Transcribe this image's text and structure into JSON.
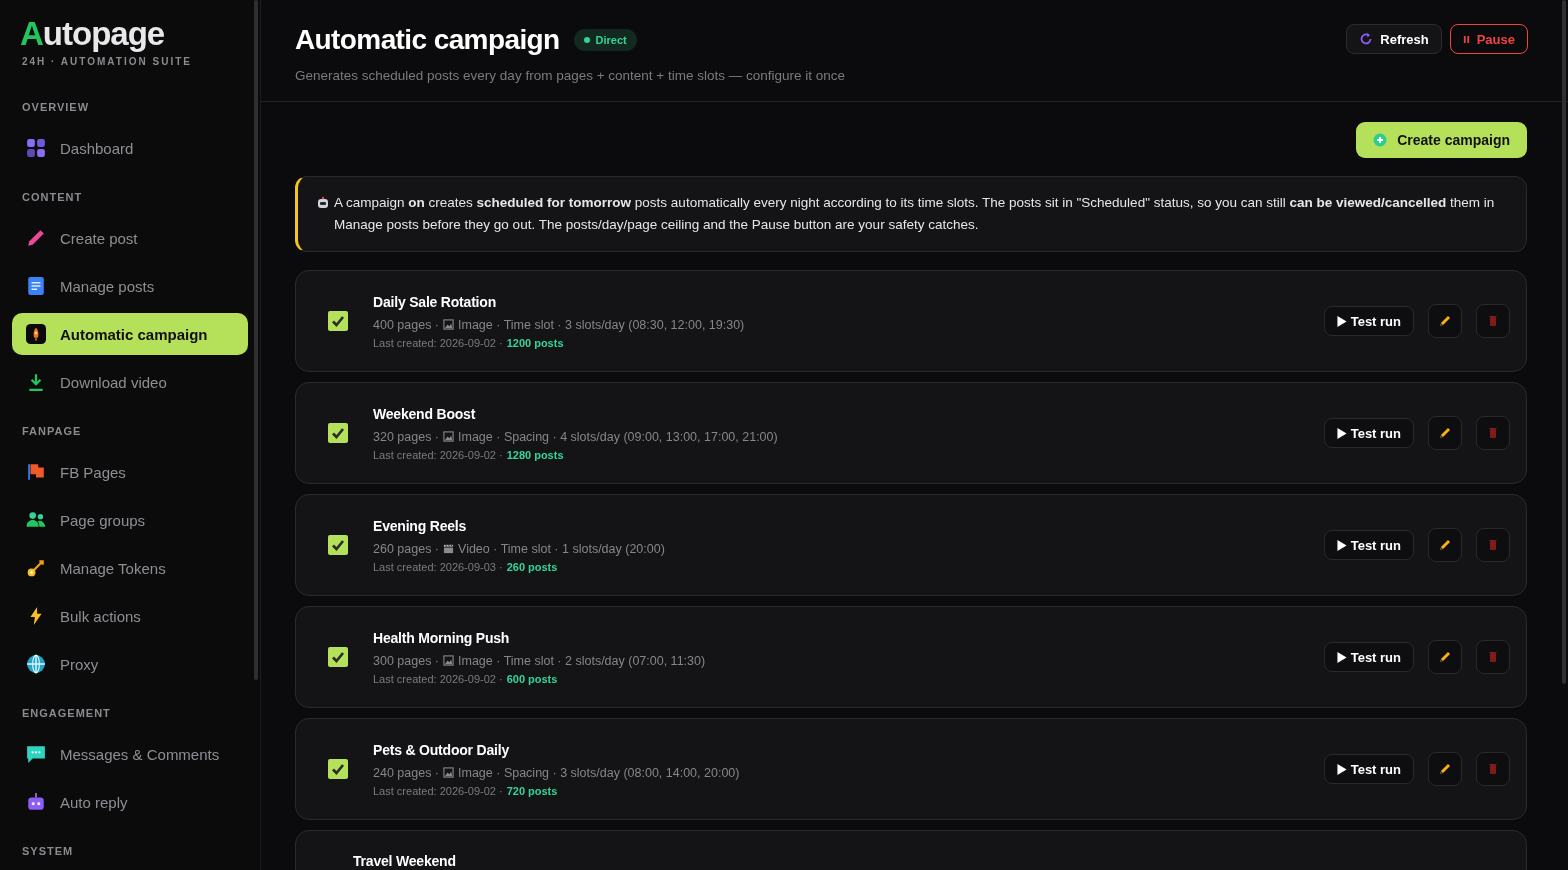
{
  "brand": {
    "logo_first": "A",
    "logo_rest": "utopage",
    "tagline": "24H · AUTOMATION SUITE"
  },
  "sidebar": {
    "sections": [
      {
        "heading": "OVERVIEW",
        "items": [
          {
            "label": "Dashboard",
            "kind": "dashboard",
            "selected": false
          }
        ]
      },
      {
        "heading": "CONTENT",
        "items": [
          {
            "label": "Create post",
            "kind": "pencil",
            "selected": false
          },
          {
            "label": "Manage posts",
            "kind": "document",
            "selected": false
          },
          {
            "label": "Automatic campaign",
            "kind": "rocket",
            "selected": true
          },
          {
            "label": "Download video",
            "kind": "download",
            "selected": false
          }
        ]
      },
      {
        "heading": "FANPAGE",
        "items": [
          {
            "label": "FB Pages",
            "kind": "flag",
            "selected": false
          },
          {
            "label": "Page groups",
            "kind": "people",
            "selected": false
          },
          {
            "label": "Manage Tokens",
            "kind": "key",
            "selected": false
          },
          {
            "label": "Bulk actions",
            "kind": "bolt",
            "selected": false
          },
          {
            "label": "Proxy",
            "kind": "globe",
            "selected": false
          }
        ]
      },
      {
        "heading": "ENGAGEMENT",
        "items": [
          {
            "label": "Messages & Comments",
            "kind": "chat",
            "selected": false
          },
          {
            "label": "Auto reply",
            "kind": "robot",
            "selected": false
          }
        ]
      },
      {
        "heading": "SYSTEM"
      }
    ]
  },
  "header": {
    "title": "Automatic campaign",
    "badge": "Direct",
    "subtitle": "Generates scheduled posts every day from pages + content + time slots — configure it once",
    "buttons": [
      {
        "label": "Refresh",
        "kind": "refresh"
      },
      {
        "label": "Pause",
        "kind": "pause"
      }
    ]
  },
  "create_button": "Create campaign",
  "notice": "A campaign **on** creates **scheduled for tomorrow** posts automatically every night according to its time slots. The posts sit in \"Scheduled\" status, so you can still **can be viewed/cancelled** them in Manage posts before they go out. The posts/day/page ceiling and the Pause button are your safety catches.",
  "campaigns": [
    {
      "name": "Daily Sale Rotation",
      "checked": true,
      "pages": "400 pages ·",
      "kind": "image",
      "meta": "Image · Time slot · 3 slots/day (08:30, 12:00, 19:30)",
      "last_created": "Last created: 2026-09-02 ·",
      "posts": "1200 posts",
      "test_label": "Test run"
    },
    {
      "name": "Weekend Boost",
      "checked": true,
      "pages": "320 pages ·",
      "kind": "image",
      "meta": "Image · Spacing · 4 slots/day (09:00, 13:00, 17:00, 21:00)",
      "last_created": "Last created: 2026-09-02 ·",
      "posts": "1280 posts",
      "test_label": "Test run"
    },
    {
      "name": "Evening Reels",
      "checked": true,
      "pages": "260 pages ·",
      "kind": "video",
      "meta": "Video · Time slot · 1 slots/day (20:00)",
      "last_created": "Last created: 2026-09-03 ·",
      "posts": "260 posts",
      "test_label": "Test run"
    },
    {
      "name": "Health Morning Push",
      "checked": true,
      "pages": "300 pages ·",
      "kind": "image",
      "meta": "Image · Time slot · 2 slots/day (07:00, 11:30)",
      "last_created": "Last created: 2026-09-02 ·",
      "posts": "600 posts",
      "test_label": "Test run"
    },
    {
      "name": "Pets & Outdoor Daily",
      "checked": true,
      "pages": "240 pages ·",
      "kind": "image",
      "meta": "Image · Spacing · 3 slots/day (08:00, 14:00, 20:00)",
      "last_created": "Last created: 2026-09-02 ·",
      "posts": "720 posts",
      "test_label": "Test run"
    },
    {
      "name": "Travel Weekend"
    }
  ]
}
